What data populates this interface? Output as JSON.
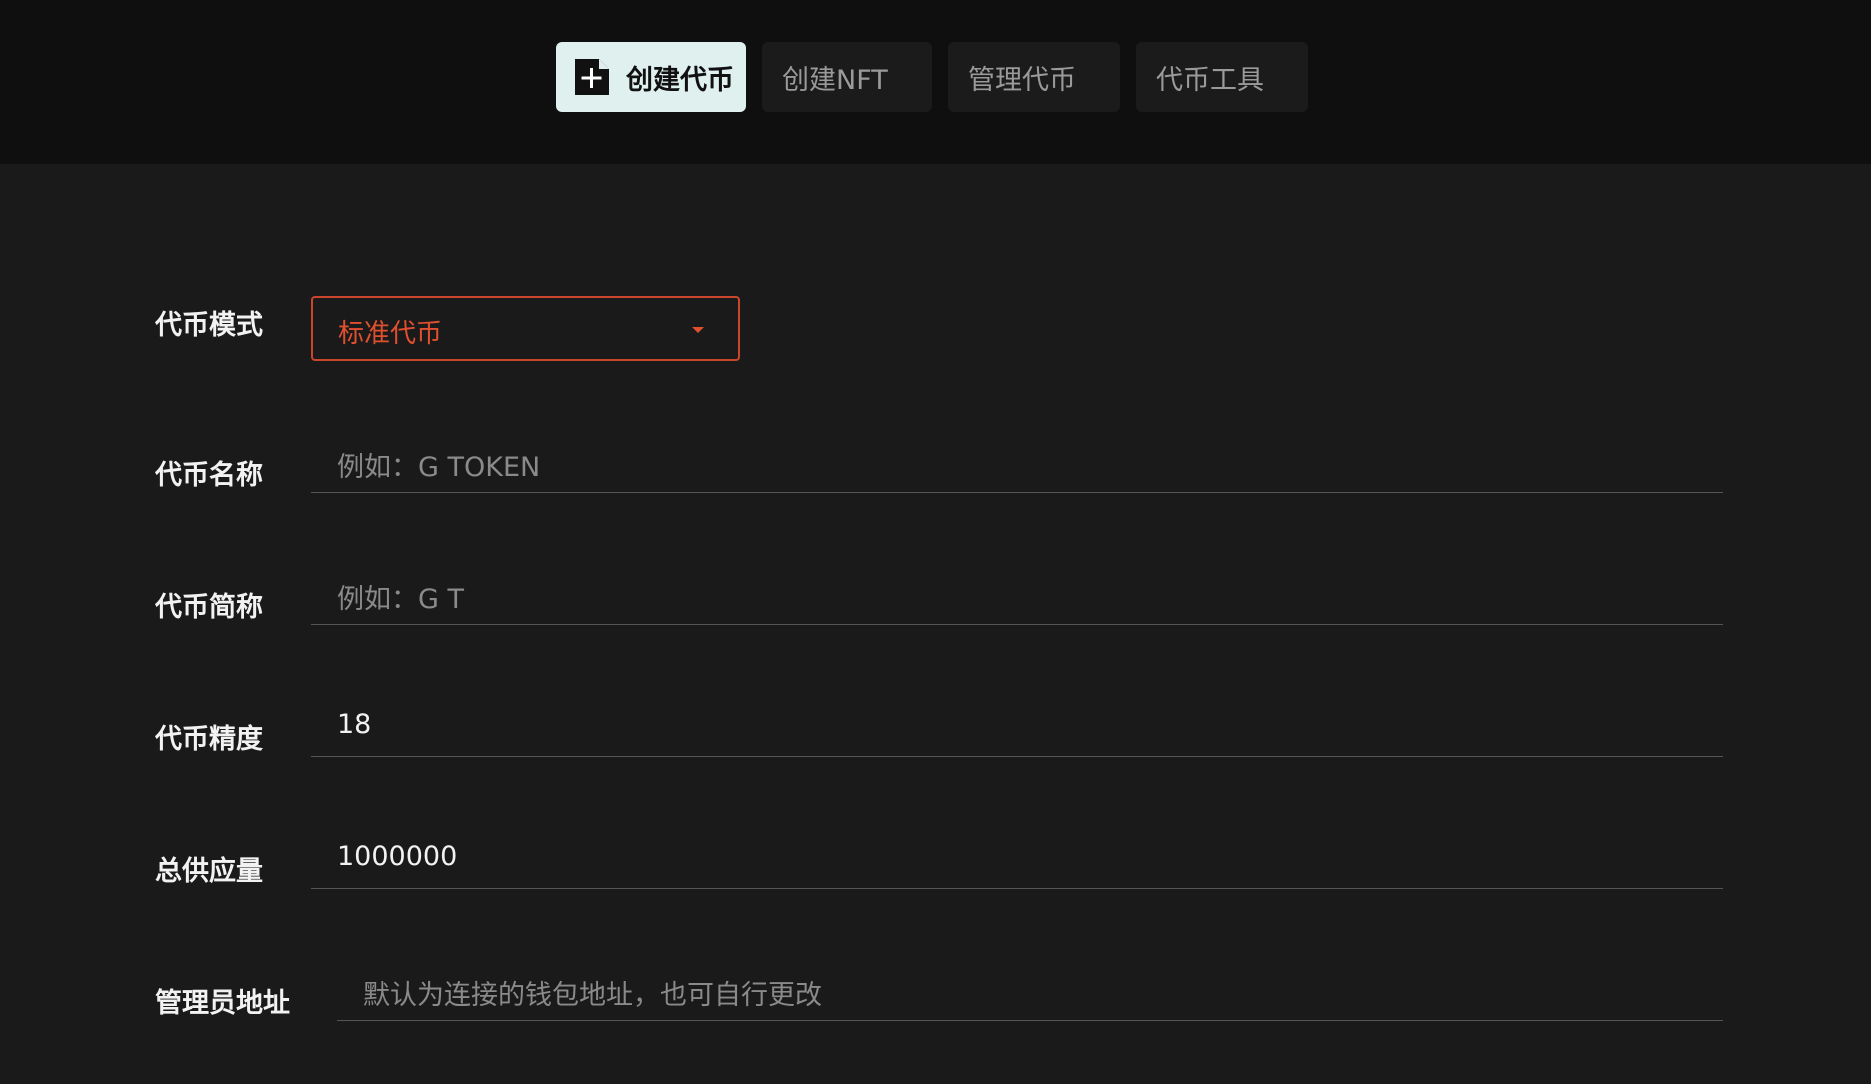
{
  "tabs": [
    {
      "label": "创建代币",
      "active": true,
      "icon": "file-plus-icon"
    },
    {
      "label": "创建NFT",
      "active": false
    },
    {
      "label": "管理代币",
      "active": false
    },
    {
      "label": "代币工具",
      "active": false
    }
  ],
  "form": {
    "mode": {
      "label": "代币模式",
      "value": "标准代币"
    },
    "name": {
      "label": "代币名称",
      "placeholder": "例如：G TOKEN"
    },
    "symbol": {
      "label": "代币简称",
      "placeholder": "例如：G T"
    },
    "decimals": {
      "label": "代币精度",
      "value": "18"
    },
    "supply": {
      "label": "总供应量",
      "value": "1000000"
    },
    "admin": {
      "label": "管理员地址",
      "placeholder": "默认为连接的钱包地址，也可自行更改"
    }
  },
  "colors": {
    "accent": "#e0502f",
    "active_tab_bg": "#dff0ee",
    "page_bg": "#1a1a1a",
    "header_bg": "#0f0f0f"
  }
}
